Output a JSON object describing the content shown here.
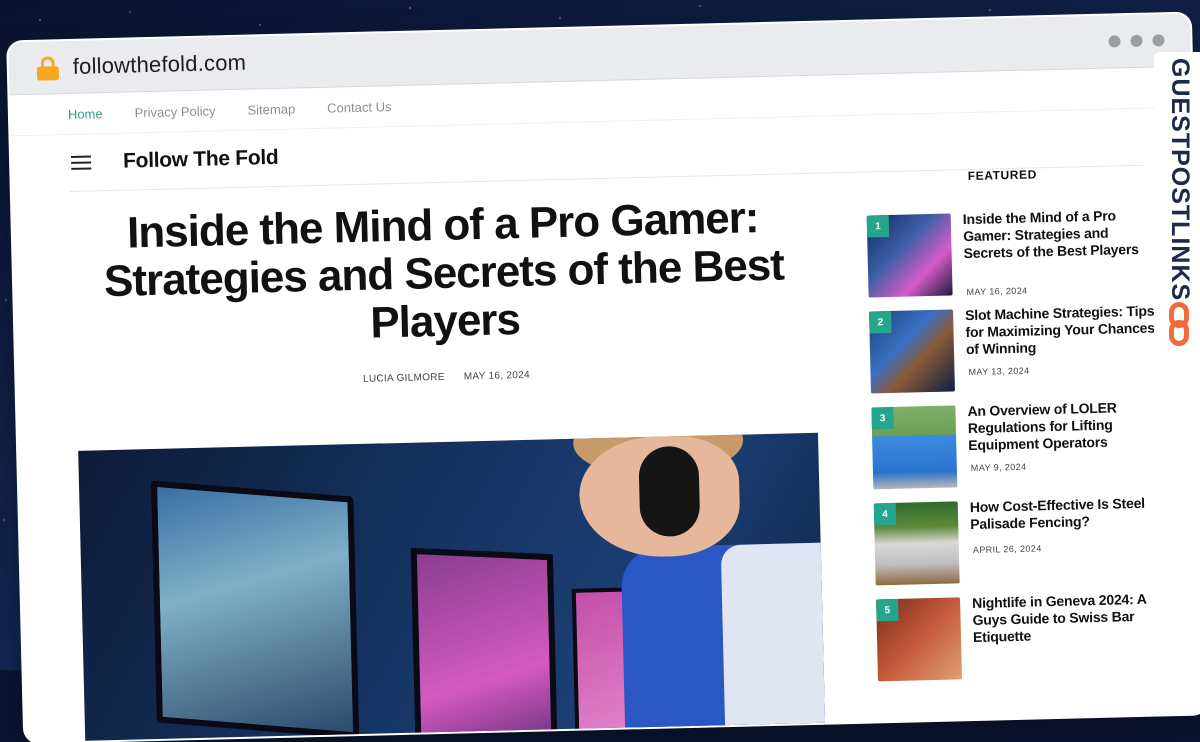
{
  "browser": {
    "url": "followthefold.com"
  },
  "topnav": [
    {
      "label": "Home",
      "active": true
    },
    {
      "label": "Privacy Policy",
      "active": false
    },
    {
      "label": "Sitemap",
      "active": false
    },
    {
      "label": "Contact Us",
      "active": false
    }
  ],
  "site": {
    "logo": "Follow The Fold"
  },
  "article": {
    "title": "Inside the Mind of a Pro Gamer: Strategies and Secrets of the Best Players",
    "author": "LUCIA GILMORE",
    "date": "MAY 16, 2024"
  },
  "sidebar": {
    "heading": "FEATURED",
    "items": [
      {
        "num": "1",
        "title": "Inside the Mind of a Pro Gamer: Strategies and Secrets of the Best Players",
        "date": "MAY 16, 2024"
      },
      {
        "num": "2",
        "title": "Slot Machine Strategies: Tips for Maximizing Your Chances of Winning",
        "date": "MAY 13, 2024"
      },
      {
        "num": "3",
        "title": "An Overview of LOLER Regulations for Lifting Equipment Operators",
        "date": "MAY 9, 2024"
      },
      {
        "num": "4",
        "title": "How Cost-Effective Is Steel Palisade Fencing?",
        "date": "APRIL 26, 2024"
      },
      {
        "num": "5",
        "title": "Nightlife in Geneva 2024: A Guys Guide to Swiss Bar Etiquette",
        "date": ""
      }
    ]
  },
  "watermark": {
    "text": "GUESTPOSTLINKS"
  },
  "colors": {
    "accent": "#25a58b",
    "lock": "#f5a623",
    "brand_orange": "#f26b3a"
  }
}
